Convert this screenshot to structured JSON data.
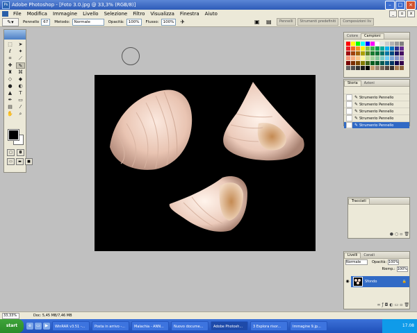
{
  "window": {
    "title": "Adobe Photoshop - [Foto 3.0.jpg @ 33,3% (RGB/8)]",
    "app_icon": "Ps"
  },
  "menu": [
    "File",
    "Modifica",
    "Immagine",
    "Livello",
    "Selezione",
    "Filtro",
    "Visualizza",
    "Finestra",
    "Aiuto"
  ],
  "options": {
    "tool_label": "Pennello",
    "brush_size": "67",
    "mode_label": "Metodo:",
    "mode_value": "Normale",
    "opacity_label": "Opacità:",
    "opacity_value": "100%",
    "flow_label": "Flusso:",
    "flow_value": "100%",
    "dock_tabs": [
      "Pennelli",
      "Strumenti predefiniti",
      "Composizioni liv"
    ]
  },
  "swatches_panel": {
    "tabs": [
      "Colore",
      "Campioni"
    ],
    "active_tab": 1,
    "colors": [
      "#ff0000",
      "#ffff00",
      "#00ff00",
      "#00ffff",
      "#0000ff",
      "#ff00ff",
      "#ffffff",
      "#e6e6e6",
      "#cccccc",
      "#b3b3b3",
      "#999999",
      "#808080",
      "#ed1c24",
      "#f26522",
      "#f7941d",
      "#fff200",
      "#8dc63f",
      "#39b54a",
      "#00a651",
      "#00a99d",
      "#00aeef",
      "#0072bc",
      "#2e3192",
      "#662d91",
      "#9e0b0f",
      "#a0410d",
      "#a36209",
      "#aba000",
      "#598527",
      "#197b30",
      "#007236",
      "#00746b",
      "#0076a3",
      "#004a80",
      "#1b1464",
      "#440e62",
      "#f69679",
      "#f9ad81",
      "#fdc689",
      "#fff799",
      "#c4df9b",
      "#a3d39c",
      "#82ca9c",
      "#7accc8",
      "#6dcff6",
      "#7da7d9",
      "#8393ca",
      "#a186be",
      "#790000",
      "#7b2e00",
      "#7d4900",
      "#827b00",
      "#406618",
      "#005e20",
      "#005826",
      "#005952",
      "#005b7f",
      "#003663",
      "#0d004c",
      "#32004b",
      "#666666",
      "#4d4d4d",
      "#333333",
      "#1a1a1a",
      "#000000",
      "#c69c6d",
      "#998675",
      "#736357",
      "#534741",
      "#362f2d",
      "#a67c52",
      "#8c6239"
    ]
  },
  "history_panel": {
    "tabs": [
      "Storia",
      "Azioni"
    ],
    "active_tab": 0,
    "items": [
      "Strumento Pennello",
      "Strumento Pennello",
      "Strumento Pennello",
      "Strumento Pennello",
      "Strumento Pennello"
    ],
    "selected_index": 4
  },
  "tracks_panel": {
    "tabs": [
      "Tracciati"
    ]
  },
  "layers_panel": {
    "tabs": [
      "Livelli",
      "Canali"
    ],
    "blend_mode": "Normale",
    "opacity_label": "Opacità:",
    "opacity_value": "100%",
    "fill_label": "Riemp.:",
    "fill_value": "100%",
    "layer_name": "Sfondo"
  },
  "status": {
    "zoom": "33,33%",
    "doc": "Doc: 5,45 MB/7,46 MB"
  },
  "taskbar": {
    "start": "start",
    "tasks": [
      "WinRAR v3.51 -...",
      "Posta in arrivo -...",
      "Malachia - ANN...",
      "Nuovo docume...",
      "Adobe Photosh...",
      "3 Esplora risor...",
      "Immagine 9.jp..."
    ],
    "active_index": 4,
    "clock": "17.08"
  }
}
